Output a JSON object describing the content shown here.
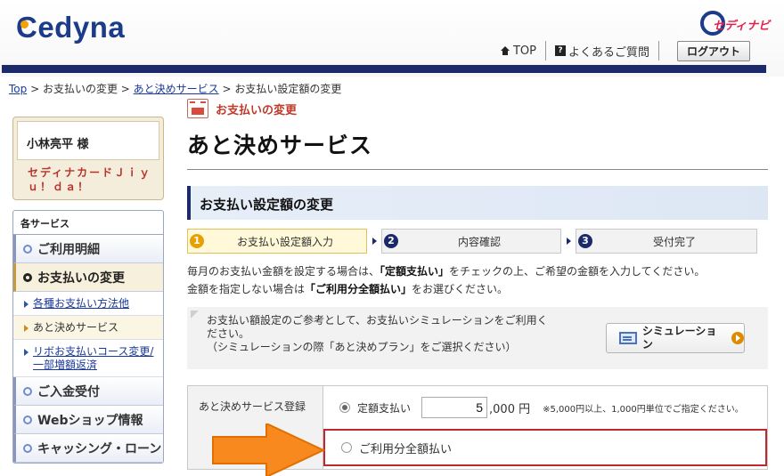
{
  "header": {
    "logo_text": "Cedyna",
    "navi_logo_text": "セディナビ",
    "links": {
      "top": "TOP",
      "faq": "よくあるご質問",
      "logout": "ログアウト"
    },
    "faq_icon_glyph": "?"
  },
  "breadcrumb": {
    "top": "Top",
    "sep1": " > ",
    "payment_change": "お支払いの変更",
    "sep2": " > ",
    "atokime": "あと決めサービス",
    "sep3": " > ",
    "current": "お支払い設定額の変更"
  },
  "sidebar": {
    "user_name": "小林亮平 様",
    "card_name": "セディナカードＪｉｙ ｕ！ｄａ！",
    "services_heading": "各サービス",
    "menu": {
      "usage": "ご利用明細",
      "payment_change": "お支払いの変更",
      "sub_methods": "各種お支払い方法他",
      "sub_atokime": "あと決めサービス",
      "sub_revo": "リボお支払いコース変更/一部増額返済",
      "deposit": "ご入金受付",
      "webshop": "Webショップ情報",
      "cashing": "キャッシング・ローン"
    }
  },
  "main": {
    "category": "お支払いの変更",
    "title": "あと決めサービス",
    "section_title": "お支払い設定額の変更",
    "steps": [
      {
        "num": "1",
        "label": "お支払い設定額入力",
        "current": true
      },
      {
        "num": "2",
        "label": "内容確認",
        "current": false
      },
      {
        "num": "3",
        "label": "受付完了",
        "current": false
      }
    ],
    "desc": {
      "l1_pre": "毎月のお支払い金額を設定する場合は、",
      "l1_bold": "「定額支払い」",
      "l1_post": "をチェックの上、ご希望の金額を入力してください。",
      "l2_pre": "金額を指定しない場合は",
      "l2_bold": "「ご利用分全額払い」",
      "l2_post": "をお選びください。"
    },
    "simulation": {
      "text1": "お支払い額設定のご参考として、お支払いシミュレーションをご利用く",
      "text2": "ださい。",
      "text3": "（シミュレーションの際「あと決めプラン」をご選択ください）",
      "button": "シミュレーション"
    },
    "form": {
      "label": "あと決めサービス登録",
      "option_fixed": "定額支払い",
      "amount_value": "5",
      "amount_suffix": ",000 円",
      "note": "※5,000円以上、1,000円単位でご指定ください。",
      "option_full": "ご利用分全額払い",
      "selected": "定額支払い"
    }
  },
  "colors": {
    "brand_navy": "#1c2a6b",
    "accent_orange": "#f7891f",
    "highlight_red": "#c0282d"
  }
}
